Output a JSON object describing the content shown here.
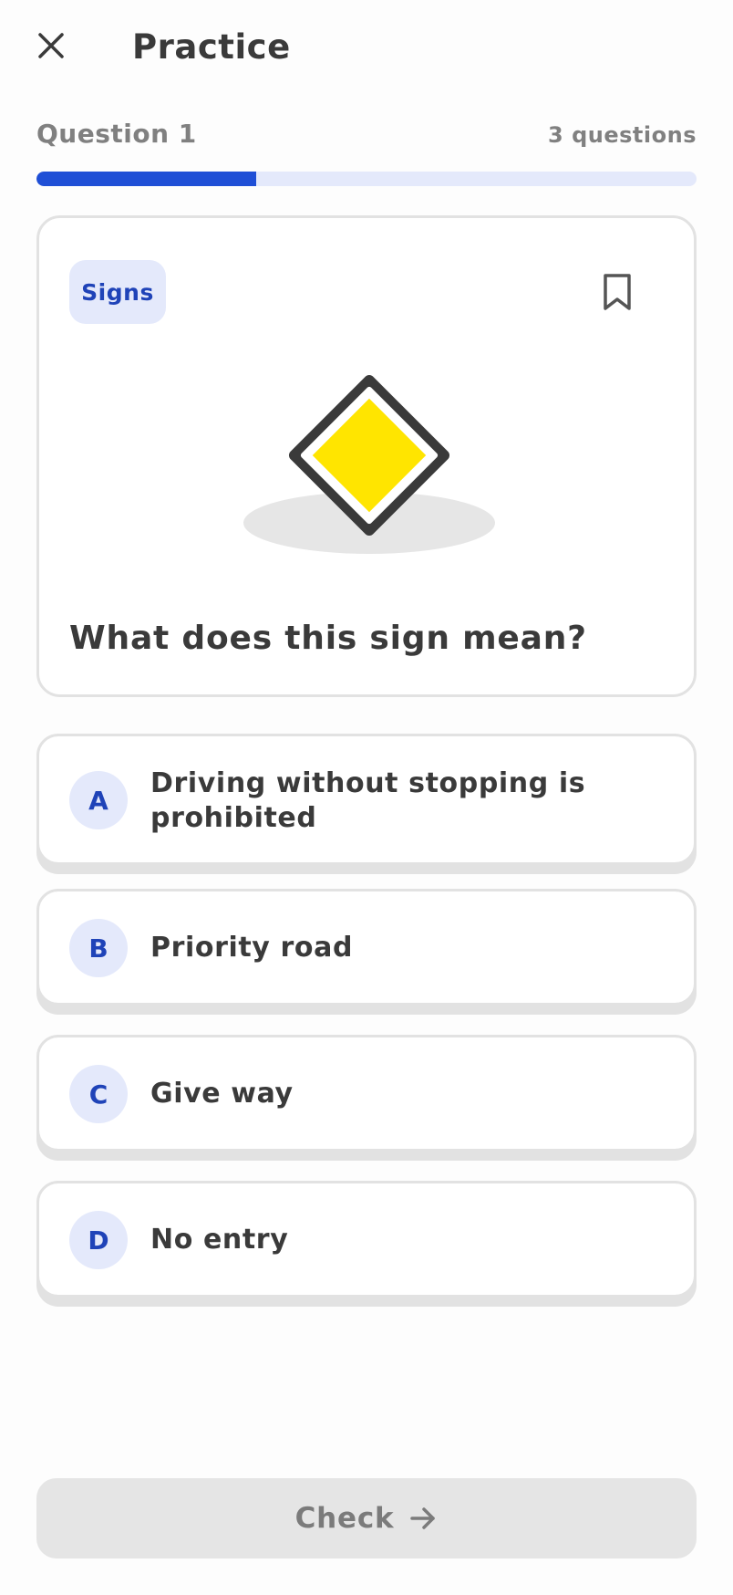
{
  "header": {
    "close_icon": "close-icon",
    "title": "Practice"
  },
  "progress": {
    "question_label": "Question 1",
    "total_label": "3 questions",
    "fraction": 0.333,
    "fill_color": "#1f4fd6",
    "track_color": "#e4e9fb"
  },
  "question": {
    "category": "Signs",
    "bookmark_icon": "bookmark-icon",
    "image": "priority-road-sign",
    "sign_colors": {
      "fill": "#ffe500",
      "border": "#3a3a3a"
    },
    "text": "What does this sign mean?"
  },
  "options": [
    {
      "letter": "A",
      "text": "Driving without stopping is prohibited"
    },
    {
      "letter": "B",
      "text": "Priority road"
    },
    {
      "letter": "C",
      "text": "Give way"
    },
    {
      "letter": "D",
      "text": "No entry"
    }
  ],
  "footer": {
    "check_label": "Check",
    "arrow_icon": "arrow-right-icon"
  },
  "colors": {
    "accent": "#1f4fd6",
    "accent_text": "#1f43b8",
    "badge_bg": "#e4e9fb",
    "disabled_button": "#e5e5e5"
  }
}
